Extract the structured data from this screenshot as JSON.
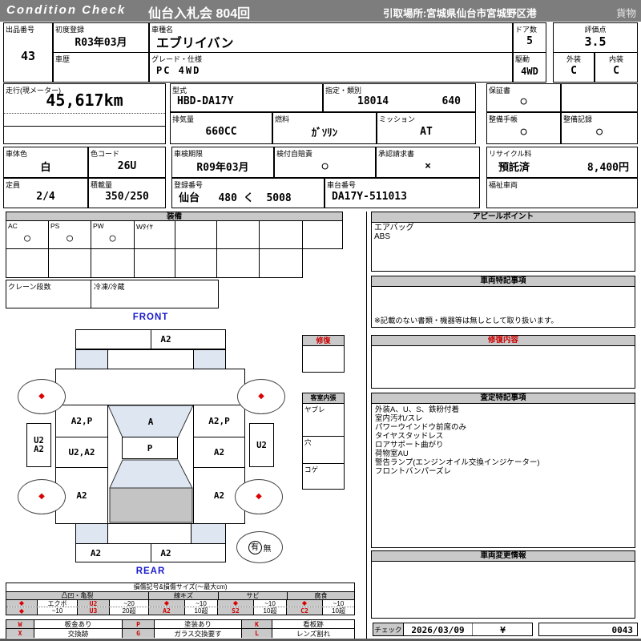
{
  "header": {
    "brand": "Condition  Check",
    "title": "仙台入札会  804回",
    "pickup": "引取場所:宮城県仙台市宮城野区港",
    "cargo": "貨物"
  },
  "fields": {
    "lot": {
      "label": "出品番号",
      "value": "43"
    },
    "first_reg": {
      "label": "初度登録",
      "value": "R03年03月"
    },
    "model_name": {
      "label": "車種名",
      "value": "エブリイバン"
    },
    "doors": {
      "label": "ドア数",
      "value": "5"
    },
    "score": {
      "label": "評価点",
      "value": "3.5"
    },
    "history": {
      "label": "車歴",
      "value": ""
    },
    "grade": {
      "label": "グレード・仕様",
      "value": "PC 4WD"
    },
    "drive": {
      "label": "駆動",
      "value": "4WD"
    },
    "exterior": {
      "label": "外装",
      "value": "C"
    },
    "interior": {
      "label": "内装",
      "value": "C"
    },
    "mileage": {
      "label": "走行(現メーター)",
      "value": "45,617km"
    },
    "model_code": {
      "label": "型式",
      "value": "HBD-DA17Y"
    },
    "designation": {
      "label": "指定・類別",
      "value1": "18014",
      "value2": "640"
    },
    "warranty": {
      "label": "保証書",
      "value": "○"
    },
    "displacement": {
      "label": "排気量",
      "value": "660CC"
    },
    "fuel": {
      "label": "燃料",
      "value": "ｶﾞｿﾘﾝ"
    },
    "mission": {
      "label": "ミッション",
      "value": "AT"
    },
    "maint_book": {
      "label": "整備手帳",
      "value": "○"
    },
    "maint_record": {
      "label": "整備記録",
      "value": "○"
    },
    "body_color": {
      "label": "車体色",
      "value": "白"
    },
    "color_code": {
      "label": "色コード",
      "value": "26U"
    },
    "inspection": {
      "label": "車検期限",
      "value": "R09年03月"
    },
    "insurance": {
      "label": "検付自賠責",
      "value": "○"
    },
    "approval": {
      "label": "承認請求書",
      "value": "×"
    },
    "recycle": {
      "label": "リサイクル料",
      "value": "預託済",
      "amount": "8,400円"
    },
    "capacity": {
      "label": "定員",
      "value": "2/4"
    },
    "load": {
      "label": "積載量",
      "value": "350/250"
    },
    "reg_number": {
      "label": "登録番号",
      "value": "仙台   480 く  5008"
    },
    "chassis": {
      "label": "車台番号",
      "value": "DA17Y-511013"
    },
    "welfare": {
      "label": "福祉車両",
      "value": ""
    }
  },
  "equipment": {
    "title": "装備",
    "items": [
      {
        "label": "AC",
        "value": "○"
      },
      {
        "label": "PS",
        "value": "○"
      },
      {
        "label": "PW",
        "value": "○"
      },
      {
        "label": "Wﾀｲﾔ",
        "value": ""
      }
    ],
    "crane_label": "クレーン段数",
    "freezer_label": "冷凍/冷蔵"
  },
  "appeal": {
    "title": "アピールポイント",
    "lines": [
      "エアバッグ",
      "ABS"
    ]
  },
  "vehicle_notes": {
    "title": "車両特記事項",
    "note": "※記載のない書類・機器等は無しとして取り扱います。"
  },
  "repair_box": {
    "title": "修復"
  },
  "repair_detail": {
    "title": "修復内容"
  },
  "cabin": {
    "title": "客室内張",
    "items": [
      "ヤブレ",
      "穴",
      "コゲ"
    ]
  },
  "assessment": {
    "title": "査定特記事項",
    "lines": [
      "外装A、U、S、鉄粉付着",
      "室内汚れ/スレ",
      "パワーウインドウ前席のみ",
      "タイヤスタッドレス",
      "ロアサポート曲がり",
      "荷物室AU",
      "警告ランプ(エンジンオイル交換インジケーター)",
      "フロントバンパーズレ"
    ]
  },
  "change_info": {
    "title": "車両変更情報"
  },
  "diagram": {
    "front_label": "FRONT",
    "rear_label": "REAR",
    "front_bumper_right": "A2",
    "windshield": "A",
    "roof": "P",
    "left_front_door": "A2,P",
    "right_front_door": "A2,P",
    "left_rear_door": "U2,A2",
    "right_rear_door": "A2",
    "left_quarter": "A2",
    "right_quarter": "A2",
    "left_side_top": "U2",
    "left_side_bottom": "A2",
    "right_side": "U2",
    "rear_bumper_left": "A2",
    "rear_bumper_right": "A2",
    "spare_yes": "有",
    "spare_no": "無",
    "diamond": "◆"
  },
  "legend": {
    "title": "損傷記号&損傷サイズ(〜最大cm)",
    "groups": [
      "凸凹・亀裂",
      "線キズ",
      "サビ",
      "腐食"
    ],
    "row1": [
      "◆",
      "エクボ",
      "U2",
      "~20",
      "◆",
      "~10",
      "◆",
      "~10",
      "◆",
      "~10"
    ],
    "row2": [
      "◆",
      "~10",
      "U3",
      "20超",
      "A2",
      "10超",
      "S2",
      "10超",
      "C2",
      "10超"
    ]
  },
  "symbols": {
    "row1": [
      {
        "code": "W",
        "desc": "板金あり"
      },
      {
        "code": "P",
        "desc": "塗装あり"
      },
      {
        "code": "K",
        "desc": "看板跡"
      }
    ],
    "row2": [
      {
        "code": "X",
        "desc": "交換跡"
      },
      {
        "code": "G",
        "desc": "ガラス交換要す"
      },
      {
        "code": "L",
        "desc": "レンズ割れ"
      }
    ]
  },
  "check": {
    "label": "チェック",
    "date": "2026/03/09",
    "mark": "¥",
    "number": "0043"
  },
  "colors": {
    "accent_red": "#cc0000",
    "glass_blue": "#dde6f1",
    "bar_gray": "#7d7d7d",
    "strip_gray": "#c9c9c9"
  }
}
